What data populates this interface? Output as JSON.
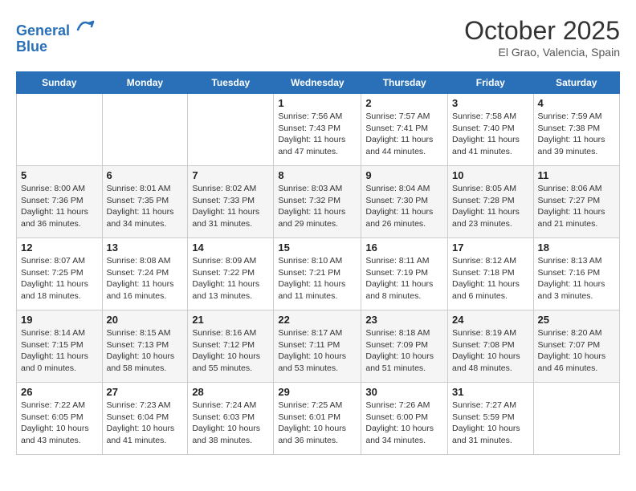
{
  "header": {
    "logo_line1": "General",
    "logo_line2": "Blue",
    "title": "October 2025",
    "location": "El Grao, Valencia, Spain"
  },
  "weekdays": [
    "Sunday",
    "Monday",
    "Tuesday",
    "Wednesday",
    "Thursday",
    "Friday",
    "Saturday"
  ],
  "weeks": [
    [
      {
        "day": "",
        "info": ""
      },
      {
        "day": "",
        "info": ""
      },
      {
        "day": "",
        "info": ""
      },
      {
        "day": "1",
        "info": "Sunrise: 7:56 AM\nSunset: 7:43 PM\nDaylight: 11 hours\nand 47 minutes."
      },
      {
        "day": "2",
        "info": "Sunrise: 7:57 AM\nSunset: 7:41 PM\nDaylight: 11 hours\nand 44 minutes."
      },
      {
        "day": "3",
        "info": "Sunrise: 7:58 AM\nSunset: 7:40 PM\nDaylight: 11 hours\nand 41 minutes."
      },
      {
        "day": "4",
        "info": "Sunrise: 7:59 AM\nSunset: 7:38 PM\nDaylight: 11 hours\nand 39 minutes."
      }
    ],
    [
      {
        "day": "5",
        "info": "Sunrise: 8:00 AM\nSunset: 7:36 PM\nDaylight: 11 hours\nand 36 minutes."
      },
      {
        "day": "6",
        "info": "Sunrise: 8:01 AM\nSunset: 7:35 PM\nDaylight: 11 hours\nand 34 minutes."
      },
      {
        "day": "7",
        "info": "Sunrise: 8:02 AM\nSunset: 7:33 PM\nDaylight: 11 hours\nand 31 minutes."
      },
      {
        "day": "8",
        "info": "Sunrise: 8:03 AM\nSunset: 7:32 PM\nDaylight: 11 hours\nand 29 minutes."
      },
      {
        "day": "9",
        "info": "Sunrise: 8:04 AM\nSunset: 7:30 PM\nDaylight: 11 hours\nand 26 minutes."
      },
      {
        "day": "10",
        "info": "Sunrise: 8:05 AM\nSunset: 7:28 PM\nDaylight: 11 hours\nand 23 minutes."
      },
      {
        "day": "11",
        "info": "Sunrise: 8:06 AM\nSunset: 7:27 PM\nDaylight: 11 hours\nand 21 minutes."
      }
    ],
    [
      {
        "day": "12",
        "info": "Sunrise: 8:07 AM\nSunset: 7:25 PM\nDaylight: 11 hours\nand 18 minutes."
      },
      {
        "day": "13",
        "info": "Sunrise: 8:08 AM\nSunset: 7:24 PM\nDaylight: 11 hours\nand 16 minutes."
      },
      {
        "day": "14",
        "info": "Sunrise: 8:09 AM\nSunset: 7:22 PM\nDaylight: 11 hours\nand 13 minutes."
      },
      {
        "day": "15",
        "info": "Sunrise: 8:10 AM\nSunset: 7:21 PM\nDaylight: 11 hours\nand 11 minutes."
      },
      {
        "day": "16",
        "info": "Sunrise: 8:11 AM\nSunset: 7:19 PM\nDaylight: 11 hours\nand 8 minutes."
      },
      {
        "day": "17",
        "info": "Sunrise: 8:12 AM\nSunset: 7:18 PM\nDaylight: 11 hours\nand 6 minutes."
      },
      {
        "day": "18",
        "info": "Sunrise: 8:13 AM\nSunset: 7:16 PM\nDaylight: 11 hours\nand 3 minutes."
      }
    ],
    [
      {
        "day": "19",
        "info": "Sunrise: 8:14 AM\nSunset: 7:15 PM\nDaylight: 11 hours\nand 0 minutes."
      },
      {
        "day": "20",
        "info": "Sunrise: 8:15 AM\nSunset: 7:13 PM\nDaylight: 10 hours\nand 58 minutes."
      },
      {
        "day": "21",
        "info": "Sunrise: 8:16 AM\nSunset: 7:12 PM\nDaylight: 10 hours\nand 55 minutes."
      },
      {
        "day": "22",
        "info": "Sunrise: 8:17 AM\nSunset: 7:11 PM\nDaylight: 10 hours\nand 53 minutes."
      },
      {
        "day": "23",
        "info": "Sunrise: 8:18 AM\nSunset: 7:09 PM\nDaylight: 10 hours\nand 51 minutes."
      },
      {
        "day": "24",
        "info": "Sunrise: 8:19 AM\nSunset: 7:08 PM\nDaylight: 10 hours\nand 48 minutes."
      },
      {
        "day": "25",
        "info": "Sunrise: 8:20 AM\nSunset: 7:07 PM\nDaylight: 10 hours\nand 46 minutes."
      }
    ],
    [
      {
        "day": "26",
        "info": "Sunrise: 7:22 AM\nSunset: 6:05 PM\nDaylight: 10 hours\nand 43 minutes."
      },
      {
        "day": "27",
        "info": "Sunrise: 7:23 AM\nSunset: 6:04 PM\nDaylight: 10 hours\nand 41 minutes."
      },
      {
        "day": "28",
        "info": "Sunrise: 7:24 AM\nSunset: 6:03 PM\nDaylight: 10 hours\nand 38 minutes."
      },
      {
        "day": "29",
        "info": "Sunrise: 7:25 AM\nSunset: 6:01 PM\nDaylight: 10 hours\nand 36 minutes."
      },
      {
        "day": "30",
        "info": "Sunrise: 7:26 AM\nSunset: 6:00 PM\nDaylight: 10 hours\nand 34 minutes."
      },
      {
        "day": "31",
        "info": "Sunrise: 7:27 AM\nSunset: 5:59 PM\nDaylight: 10 hours\nand 31 minutes."
      },
      {
        "day": "",
        "info": ""
      }
    ]
  ]
}
